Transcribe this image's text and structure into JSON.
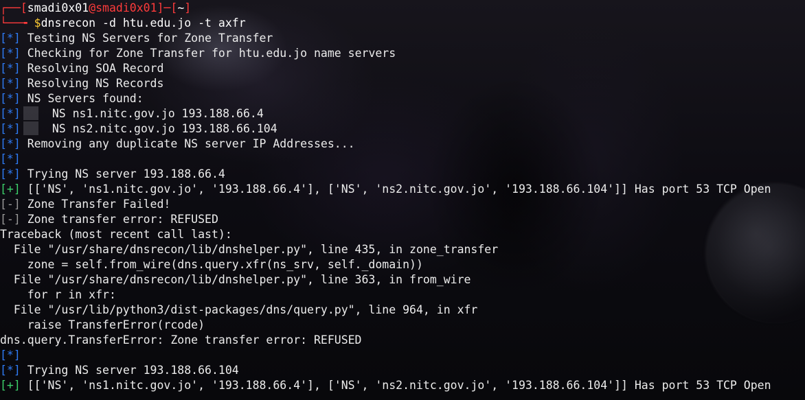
{
  "prompt": {
    "corner": "┌──",
    "bracket_open": "[",
    "user": "smadi0x01",
    "at": "@",
    "host": "smadi0x01",
    "bracket_close": "]",
    "dash": "─",
    "dir_open": "[",
    "dir": "~",
    "dir_close": "]",
    "lower_corner": "└──╼ ",
    "dollar": "$",
    "command": "dnsrecon -d htu.edu.jo -t axfr"
  },
  "colors": {
    "info_prefix": "#2f7cf6",
    "success_prefix": "#3dd26b",
    "error_prefix": "#9a9a9a",
    "prompt_accent": "#ff3b3b",
    "dollar": "#ffcc33",
    "text": "#ececec"
  },
  "output": [
    {
      "prefix": "[*]",
      "kind": "info",
      "text": " Testing NS Servers for Zone Transfer"
    },
    {
      "prefix": "[*]",
      "kind": "info",
      "text": " Checking for Zone Transfer for htu.edu.jo name servers"
    },
    {
      "prefix": "[*]",
      "kind": "info",
      "text": " Resolving SOA Record"
    },
    {
      "prefix": "[*]",
      "kind": "info",
      "text": " Resolving NS Records"
    },
    {
      "prefix": "[*]",
      "kind": "info",
      "text": " NS Servers found:"
    },
    {
      "prefix": "[*]",
      "kind": "info",
      "text": "NS ns1.nitc.gov.jo 193.188.66.4",
      "indented": true
    },
    {
      "prefix": "[*]",
      "kind": "info",
      "text": "NS ns2.nitc.gov.jo 193.188.66.104",
      "indented": true
    },
    {
      "prefix": "[*]",
      "kind": "info",
      "text": " Removing any duplicate NS server IP Addresses..."
    },
    {
      "prefix": "[*]",
      "kind": "info",
      "text": ""
    },
    {
      "prefix": "[*]",
      "kind": "info",
      "text": " Trying NS server 193.188.66.4"
    },
    {
      "prefix": "[+]",
      "kind": "success",
      "text": " [['NS', 'ns1.nitc.gov.jo', '193.188.66.4'], ['NS', 'ns2.nitc.gov.jo', '193.188.66.104']] Has port 53 TCP Open"
    },
    {
      "prefix": "[-]",
      "kind": "error",
      "text": " Zone Transfer Failed!"
    },
    {
      "prefix": "[-]",
      "kind": "error",
      "text": " Zone transfer error: REFUSED"
    },
    {
      "prefix": "",
      "kind": "plain",
      "text": "Traceback (most recent call last):"
    },
    {
      "prefix": "",
      "kind": "plain",
      "text": "  File \"/usr/share/dnsrecon/lib/dnshelper.py\", line 435, in zone_transfer"
    },
    {
      "prefix": "",
      "kind": "plain",
      "text": "    zone = self.from_wire(dns.query.xfr(ns_srv, self._domain))"
    },
    {
      "prefix": "",
      "kind": "plain",
      "text": "  File \"/usr/share/dnsrecon/lib/dnshelper.py\", line 363, in from_wire"
    },
    {
      "prefix": "",
      "kind": "plain",
      "text": "    for r in xfr:"
    },
    {
      "prefix": "",
      "kind": "plain",
      "text": "  File \"/usr/lib/python3/dist-packages/dns/query.py\", line 964, in xfr"
    },
    {
      "prefix": "",
      "kind": "plain",
      "text": "    raise TransferError(rcode)"
    },
    {
      "prefix": "",
      "kind": "plain",
      "text": "dns.query.TransferError: Zone transfer error: REFUSED"
    },
    {
      "prefix": "[*]",
      "kind": "info",
      "text": ""
    },
    {
      "prefix": "[*]",
      "kind": "info",
      "text": " Trying NS server 193.188.66.104"
    },
    {
      "prefix": "[+]",
      "kind": "success",
      "text": " [['NS', 'ns1.nitc.gov.jo', '193.188.66.4'], ['NS', 'ns2.nitc.gov.jo', '193.188.66.104']] Has port 53 TCP Open"
    }
  ]
}
